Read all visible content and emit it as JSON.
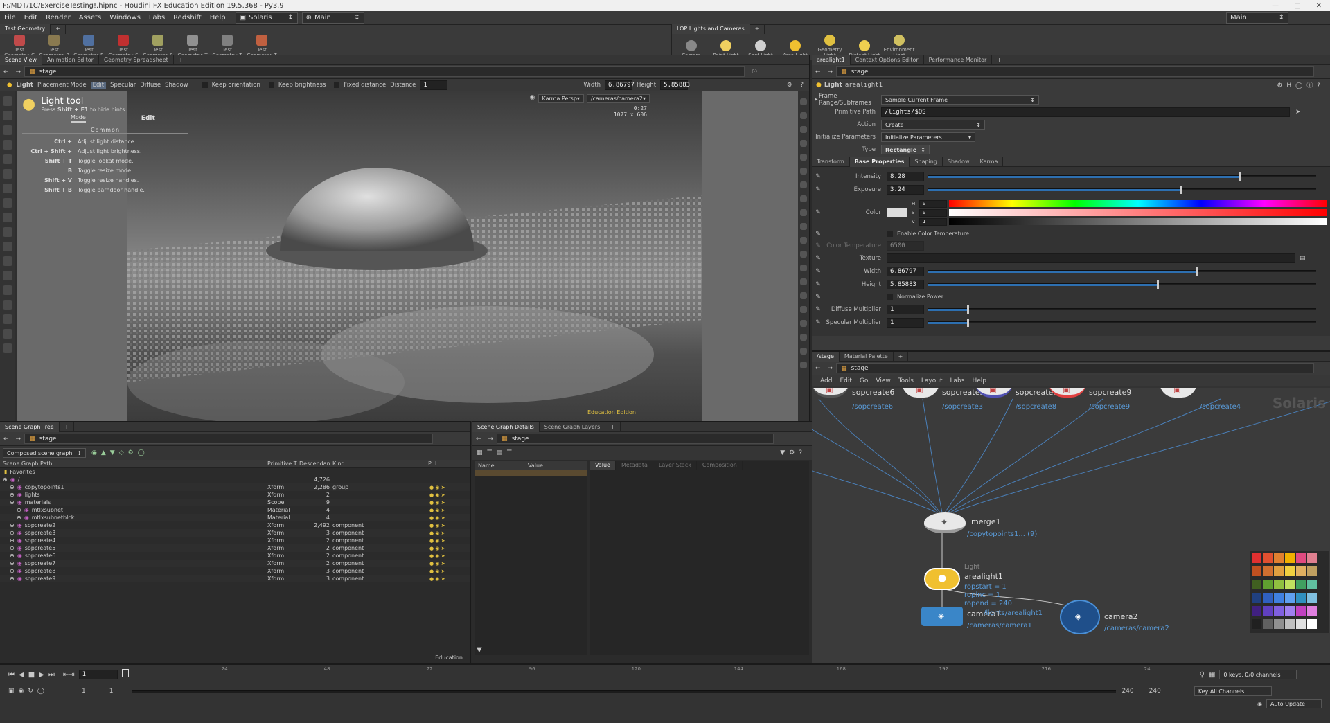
{
  "window": {
    "title": "F:/MDT/1C/ExerciseTesting!.hipnc - Houdini FX Education Edition 19.5.368 - Py3.9"
  },
  "menu": {
    "items": [
      "File",
      "Edit",
      "Render",
      "Assets",
      "Windows",
      "Labs",
      "Redshift",
      "Help"
    ],
    "desktop": "Solaris",
    "main": "Main",
    "right_main": "Main"
  },
  "shelf_left": {
    "tab": "Test Geometry",
    "tools": [
      "Test Geometry: C",
      "Test Geometry: P",
      "Test Geometry: R",
      "Test Geometry: S",
      "Test Geometry: S",
      "Test Geometry: T",
      "Test Geometry: T",
      "Test Geometry: T"
    ]
  },
  "shelf_right": {
    "tab": "LOP Lights and Cameras",
    "tools": [
      "Camera",
      "Point Light",
      "Spot Light",
      "Area Light",
      "Geometry Light",
      "Distant Light",
      "Environment Light"
    ]
  },
  "viewer_tabs": [
    "Scene View",
    "Animation Editor",
    "Geometry Spreadsheet"
  ],
  "viewer": {
    "path": "stage",
    "toolbar": {
      "light_label": "Light",
      "mode": "Placement Mode",
      "edit": "Edit",
      "specular": "Specular",
      "diffuse": "Diffuse",
      "shadow": "Shadow",
      "keep_orientation": "Keep orientation",
      "keep_brightness": "Keep brightness",
      "fixed_distance": "Fixed distance",
      "distance_label": "Distance",
      "distance_value": "1",
      "width_label": "Width",
      "width_value": "6.86797",
      "height_label": "Height",
      "height_value": "5.85883"
    },
    "renderer": "Karma Persp",
    "camera": "/cameras/camera2",
    "time": "0:27",
    "resolution": "1077 x 606",
    "edu_watermark": "Education Edition"
  },
  "hints": {
    "title": "Light tool",
    "subtitle_pre": "Press ",
    "subtitle_key": "Shift + F1",
    "subtitle_post": " to hide hints",
    "mode_tab": "Mode",
    "edit_tab": "Edit",
    "section": "Common",
    "rows": [
      {
        "keys": "Ctrl +",
        "desc": "Adjust light distance."
      },
      {
        "keys": "Ctrl + Shift +",
        "desc": "Adjust light brightness."
      },
      {
        "keys": "Shift + T",
        "desc": "Toggle lookat mode."
      },
      {
        "keys": "B",
        "desc": "Toggle resize mode."
      },
      {
        "keys": "Shift + V",
        "desc": "Toggle resize handles."
      },
      {
        "keys": "Shift + B",
        "desc": "Toggle barndoor handle."
      }
    ]
  },
  "props_tabs": [
    "arealight1",
    "Context Options Editor",
    "Performance Monitor"
  ],
  "props": {
    "path": "stage",
    "node_type": "Light",
    "node_name": "arealight1",
    "frame_range_label": "Frame Range/Subframes",
    "frame_range_value": "Sample Current Frame",
    "primitive_path_label": "Primitive Path",
    "primitive_path_value": "/lights/$OS",
    "action_label": "Action",
    "action_value": "Create",
    "init_label": "Initialize Parameters",
    "init_value": "Initialize Parameters",
    "type_label": "Type",
    "type_value": "Rectangle",
    "tabs": [
      "Transform",
      "Base Properties",
      "Shaping",
      "Shadow",
      "Karma"
    ],
    "intensity_label": "Intensity",
    "intensity": "8.28",
    "intensity_level": 0.8,
    "exposure_label": "Exposure",
    "exposure": "3.24",
    "exposure_level": 0.65,
    "color_label": "Color",
    "h_label": "H",
    "h_value": "0",
    "s_label": "S",
    "s_value": "0",
    "v_label": "V",
    "v_value": "1",
    "enable_ct": "Enable Color Temperature",
    "color_temp_label": "Color Temperature",
    "color_temp": "6500",
    "texture_label": "Texture",
    "width_label": "Width",
    "width": "6.86797",
    "width_level": 0.69,
    "height_label": "Height",
    "height": "5.85883",
    "height_level": 0.59,
    "normalize_power": "Normalize Power",
    "diffuse_label": "Diffuse Multiplier",
    "diffuse": "1",
    "diffuse_level": 0.1,
    "specular_label": "Specular Multiplier",
    "specular": "1",
    "specular_level": 0.1
  },
  "network_tabs": [
    "/stage",
    "Material Palette"
  ],
  "network": {
    "path": "stage",
    "menu": [
      "Add",
      "Edit",
      "Go",
      "View",
      "Tools",
      "Layout",
      "Labs",
      "Help"
    ],
    "top_nodes": [
      {
        "name": "sopcreate6",
        "path": "/sopcreate6"
      },
      {
        "name": "sopcreate3",
        "path": "/sopcreate3"
      },
      {
        "name": "sopcreate8",
        "path": "/sopcreate8"
      },
      {
        "name": "sopcreate9",
        "path": "/sopcreate9"
      },
      {
        "name": "",
        "path": "/sopcreate4"
      }
    ],
    "merge": {
      "name": "merge1",
      "sub": "/copytopoints1... (9)"
    },
    "light": {
      "type": "Light",
      "name": "arealight1",
      "props": [
        "ropstart = 1",
        "ropinc = 1",
        "ropend = 240"
      ],
      "overlay": "/lights/arealight1"
    },
    "camera1": {
      "name": "camera1",
      "path": "/cameras/camera1"
    },
    "camera2": {
      "name": "camera2",
      "path": "/cameras/camera2"
    },
    "watermark": "Solaris",
    "palette": [
      "#e03030",
      "#e05030",
      "#e08030",
      "#f0b000",
      "#e04a80",
      "#e08090",
      "#c05020",
      "#d07030",
      "#e0a040",
      "#f0d040",
      "#e0b060",
      "#c0a060",
      "#406020",
      "#60a030",
      "#90c040",
      "#c0e060",
      "#40a060",
      "#60c0a0",
      "#204080",
      "#3060c0",
      "#4080e0",
      "#60a0f0",
      "#3090c0",
      "#80c0e0",
      "#402080",
      "#6040c0",
      "#8060e0",
      "#a080f0",
      "#c040c0",
      "#e080e0",
      "#202020",
      "#606060",
      "#909090",
      "#c0c0c0",
      "#e0e0e0",
      "#ffffff"
    ]
  },
  "scene_tree_tabs": [
    "Scene Graph Tree"
  ],
  "scene_tree": {
    "path": "stage",
    "mode": "Composed scene graph",
    "headers": [
      "Scene Graph Path",
      "Primitive T",
      "Descendan",
      "Kind",
      "P",
      "L"
    ],
    "favorites": "Favorites",
    "rows": [
      {
        "name": "/",
        "type": "",
        "desc": "4,726",
        "kind": "",
        "indent": 0
      },
      {
        "name": "copytopoints1",
        "type": "Xform",
        "desc": "2,286",
        "kind": "group",
        "indent": 1
      },
      {
        "name": "lights",
        "type": "Xform",
        "desc": "2",
        "kind": "",
        "indent": 1
      },
      {
        "name": "materials",
        "type": "Scope",
        "desc": "9",
        "kind": "",
        "indent": 1
      },
      {
        "name": "mtlxsubnet",
        "type": "Material",
        "desc": "4",
        "kind": "",
        "indent": 2
      },
      {
        "name": "mtlxsubnetblck",
        "type": "Material",
        "desc": "4",
        "kind": "",
        "indent": 2
      },
      {
        "name": "sopcreate2",
        "type": "Xform",
        "desc": "2,492",
        "kind": "component",
        "indent": 1
      },
      {
        "name": "sopcreate3",
        "type": "Xform",
        "desc": "3",
        "kind": "component",
        "indent": 1
      },
      {
        "name": "sopcreate4",
        "type": "Xform",
        "desc": "2",
        "kind": "component",
        "indent": 1
      },
      {
        "name": "sopcreate5",
        "type": "Xform",
        "desc": "2",
        "kind": "component",
        "indent": 1
      },
      {
        "name": "sopcreate6",
        "type": "Xform",
        "desc": "2",
        "kind": "component",
        "indent": 1
      },
      {
        "name": "sopcreate7",
        "type": "Xform",
        "desc": "2",
        "kind": "component",
        "indent": 1
      },
      {
        "name": "sopcreate8",
        "type": "Xform",
        "desc": "3",
        "kind": "component",
        "indent": 1
      },
      {
        "name": "sopcreate9",
        "type": "Xform",
        "desc": "3",
        "kind": "component",
        "indent": 1
      }
    ],
    "footer": "Education"
  },
  "details_tabs": [
    "Scene Graph Details",
    "Scene Graph Layers"
  ],
  "details": {
    "path": "stage",
    "name_header": "Name",
    "value_header": "Value",
    "tabs": [
      "Value",
      "Metadata",
      "Layer Stack",
      "Composition"
    ]
  },
  "timeline": {
    "frame": "1",
    "ticks": [
      "24",
      "48",
      "72",
      "96",
      "120",
      "144",
      "168",
      "192",
      "216",
      "24"
    ],
    "start": "1",
    "start2": "1",
    "end": "240",
    "end2": "240",
    "keys": "0 keys, 0/0 channels",
    "key_all": "Key All Channels",
    "auto_update": "Auto Update"
  }
}
